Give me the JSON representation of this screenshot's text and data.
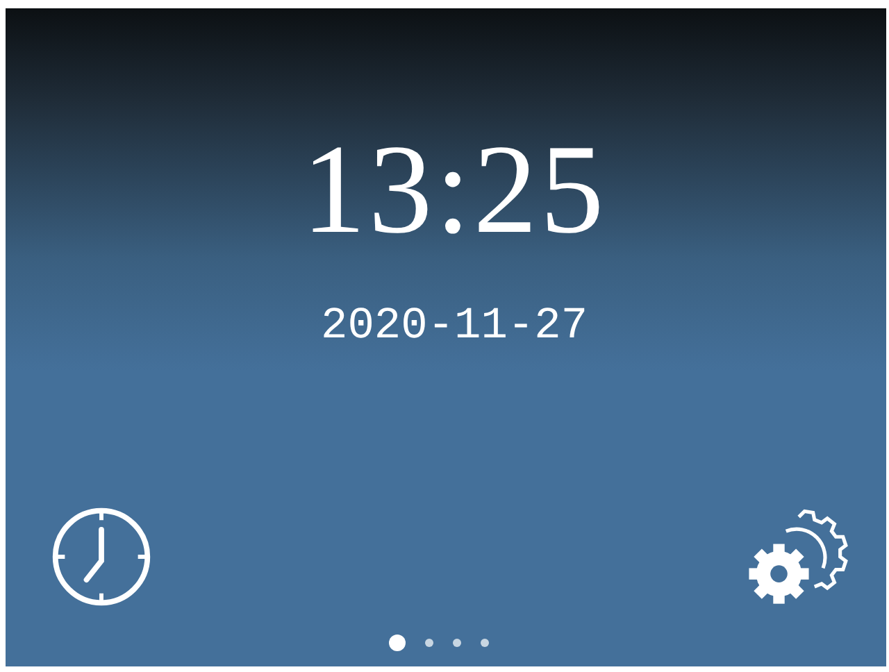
{
  "time": "13:25",
  "date": "2020-11-27",
  "shortcuts": [
    {
      "kind": "clock"
    },
    {
      "kind": "settings"
    }
  ],
  "page_dots": [
    {
      "selected": true
    },
    {
      "selected": false
    },
    {
      "selected": false
    },
    {
      "selected": false
    }
  ]
}
